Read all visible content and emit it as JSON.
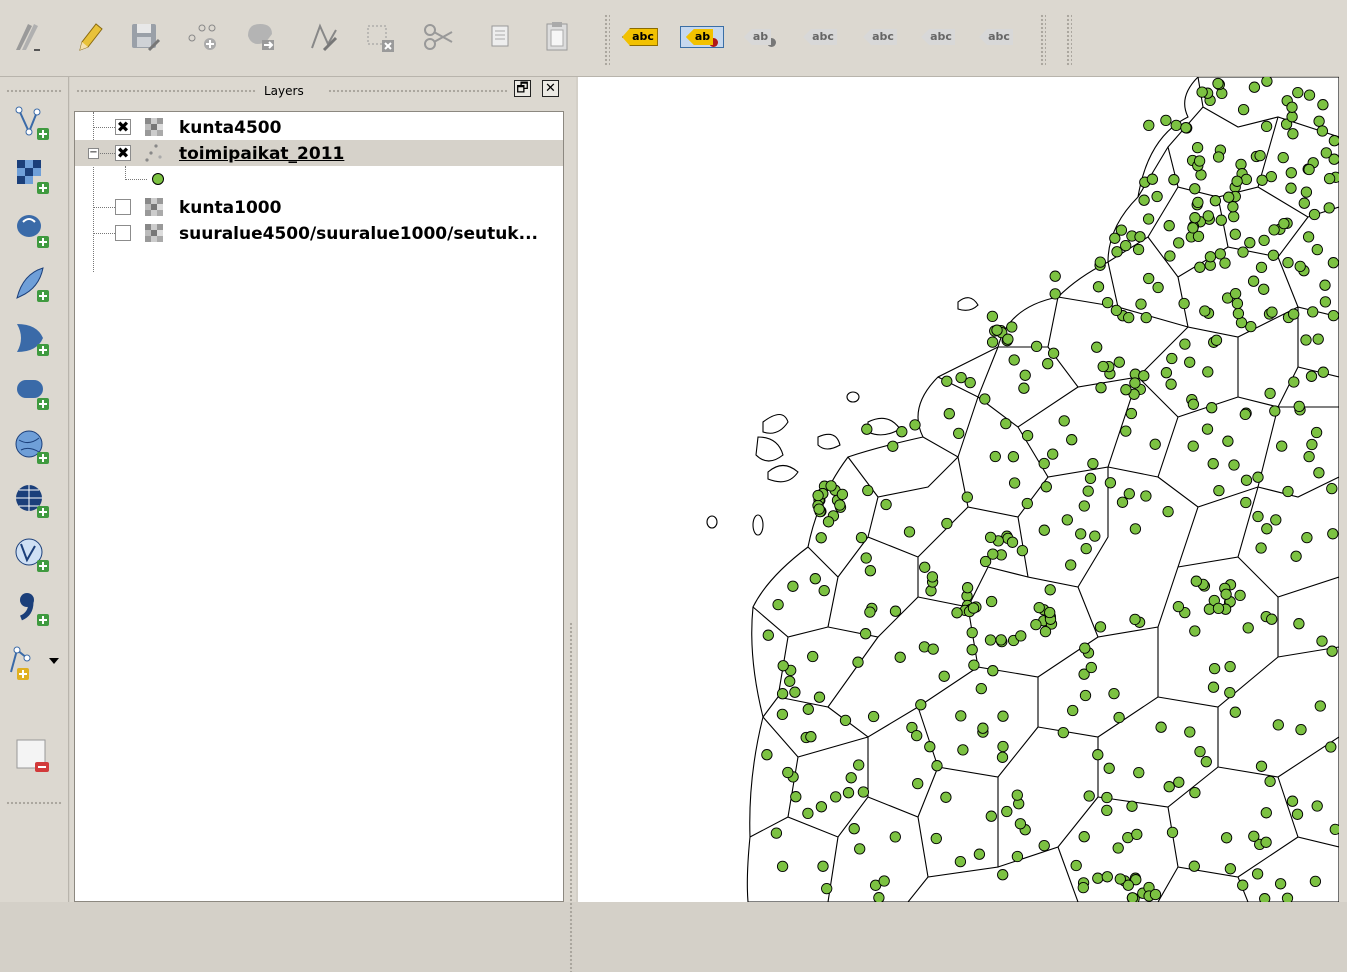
{
  "toolbar": {
    "buttons": [
      {
        "name": "digitize-icon"
      },
      {
        "name": "toggle-editing-icon"
      },
      {
        "name": "save-edits-icon"
      },
      {
        "name": "add-feature-icon"
      },
      {
        "name": "move-feature-icon"
      },
      {
        "name": "node-tool-icon"
      },
      {
        "name": "delete-selected-icon"
      },
      {
        "name": "cut-features-icon"
      },
      {
        "name": "copy-features-icon"
      },
      {
        "name": "paste-features-icon"
      }
    ],
    "label_buttons": [
      {
        "name": "label-tool-icon",
        "text": "abc",
        "color": "#f2c100"
      },
      {
        "name": "pin-labels-icon",
        "text": "ab",
        "color": "#f2c100"
      },
      {
        "name": "highlight-pinned-labels-icon",
        "text": "ab",
        "color": "#d8d8d8"
      },
      {
        "name": "show-hide-labels-icon",
        "text": "abc",
        "color": "#d8d8d8"
      },
      {
        "name": "move-label-icon",
        "text": "abc",
        "color": "#d8d8d8"
      },
      {
        "name": "rotate-label-icon",
        "text": "abc",
        "color": "#d8d8d8"
      },
      {
        "name": "change-label-icon",
        "text": "abc",
        "color": "#d8d8d8"
      }
    ]
  },
  "left_toolbar": {
    "buttons": [
      {
        "name": "add-vector-layer-icon"
      },
      {
        "name": "add-raster-layer-icon"
      },
      {
        "name": "add-postgis-layer-icon"
      },
      {
        "name": "add-spatialite-layer-icon"
      },
      {
        "name": "add-mssql-layer-icon"
      },
      {
        "name": "add-oracle-layer-icon"
      },
      {
        "name": "add-wms-layer-icon"
      },
      {
        "name": "add-wcs-layer-icon"
      },
      {
        "name": "add-wfs-layer-icon"
      },
      {
        "name": "add-delimited-text-layer-icon"
      },
      {
        "name": "new-shapefile-layer-icon"
      },
      {
        "name": "remove-layer-icon"
      }
    ]
  },
  "layers_panel": {
    "title": "Layers",
    "float_button": "🗗",
    "close_button": "✕",
    "layers": [
      {
        "name": "kunta4500",
        "checked": true,
        "type": "raster",
        "check_mark": "✖"
      },
      {
        "name": "toimipaikat_2011",
        "checked": true,
        "type": "point",
        "selected": true,
        "check_mark": "✖",
        "expander": "−"
      },
      {
        "name": "kunta1000",
        "checked": false,
        "type": "raster",
        "check_mark": ""
      },
      {
        "name": "suuralue4500/suuralue1000/seutuk...",
        "checked": false,
        "type": "raster",
        "check_mark": ""
      }
    ],
    "legend_symbol_color": "#7cc242"
  },
  "map": {
    "background": "#ffffff",
    "point_color": "#7cc242",
    "line_color": "#000000"
  }
}
